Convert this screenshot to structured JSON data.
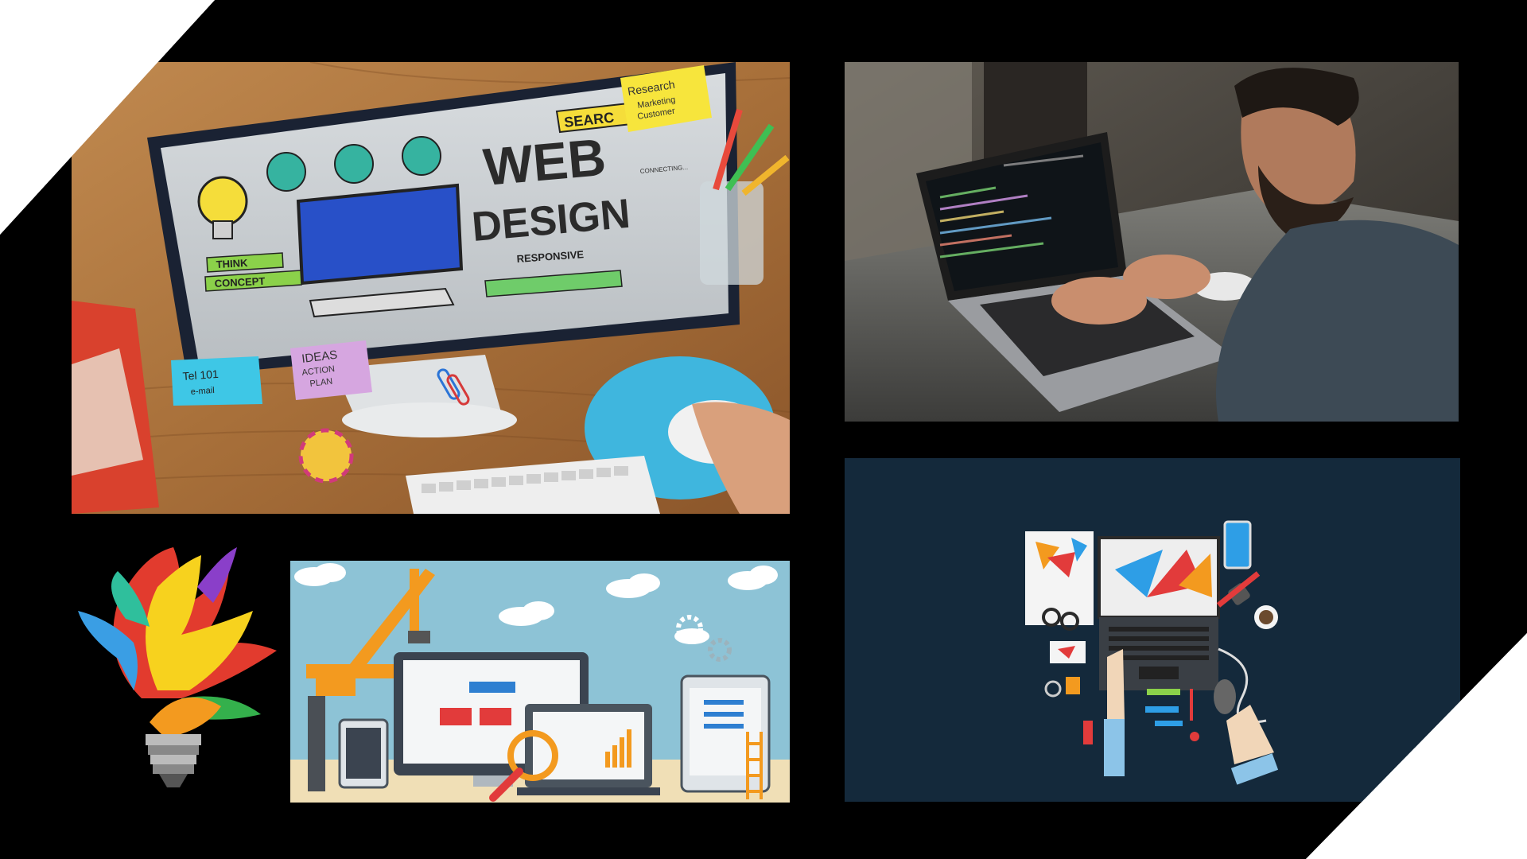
{
  "collage": {
    "web_design_photo": {
      "sign_words": [
        "WEB",
        "DESIGN"
      ],
      "search_label": "SEARC",
      "think_label": "THINK",
      "concept_label": "CONCEPT",
      "responsive_label": "RESPONSIVE",
      "connecting_label": "CONNECTING...",
      "note_research_lines": [
        "Research",
        "Marketing",
        "Customer"
      ],
      "note_ideas_lines": [
        "IDEAS",
        "ACTION",
        "PLAN"
      ],
      "note_blue_lines": [
        "Tel 101",
        "e-mail"
      ]
    },
    "developer_photo": {},
    "paint_bulb": {},
    "construction_illustration": {},
    "flat_workspace_illustration": {}
  },
  "colors": {
    "background_frame": "#000000",
    "corner_white": "#ffffff",
    "navy_panel": "#14293b",
    "sky_blue": "#8dc3d6",
    "orange_accent": "#f39a1f"
  }
}
